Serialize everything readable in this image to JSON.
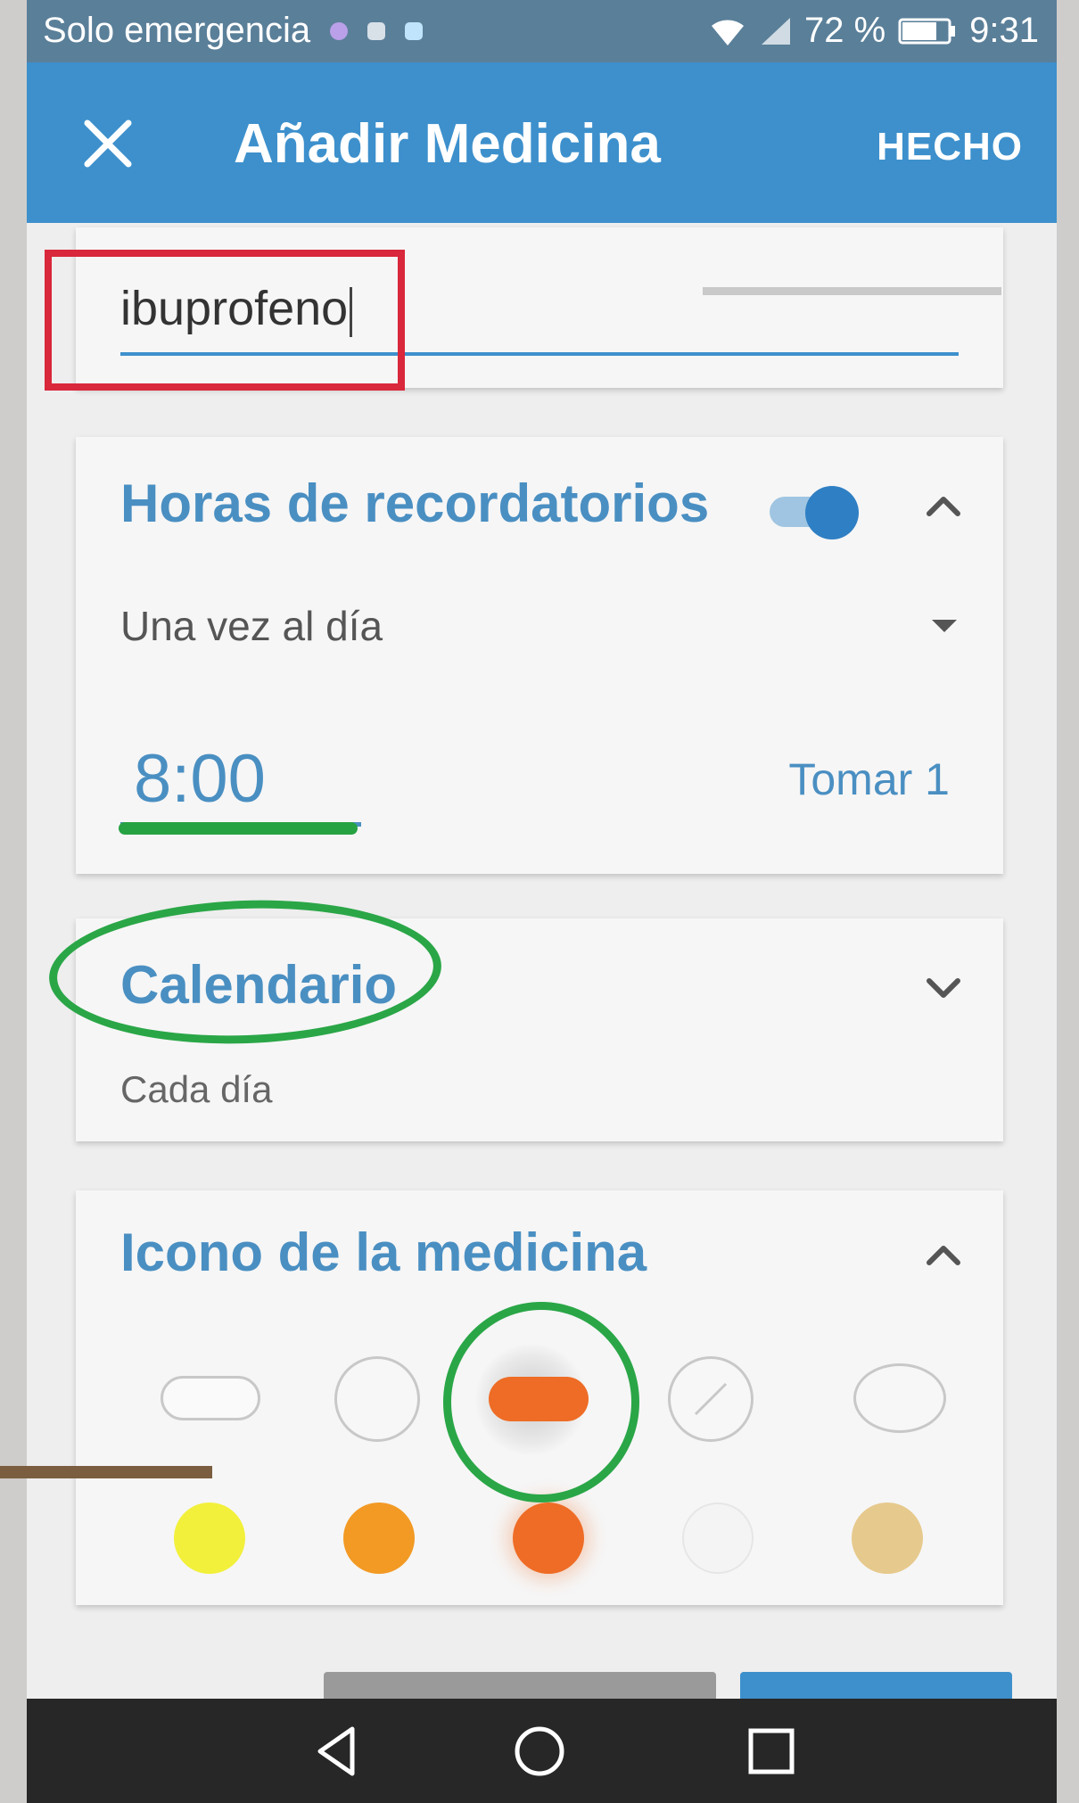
{
  "status_bar": {
    "carrier": "Solo emergencia",
    "battery": "72 %",
    "time": "9:31",
    "icons": [
      "notification-icon",
      "message-icon",
      "app-icon",
      "wifi-icon",
      "signal-icon",
      "battery-icon"
    ]
  },
  "app_bar": {
    "title": "Añadir Medicina",
    "done_label": "HECHO",
    "close_icon": "close-icon"
  },
  "medicine_name": {
    "value": "ibuprofeno"
  },
  "reminders": {
    "title": "Horas de recordatorios",
    "enabled": true,
    "frequency": "Una vez al día",
    "time": "8:00",
    "dose": "Tomar 1"
  },
  "calendar": {
    "title": "Calendario",
    "subtitle": "Cada día"
  },
  "medicine_icon": {
    "title": "Icono de la medicina",
    "shapes": [
      "capsule-icon",
      "round-pill-icon",
      "capsule-pill-icon",
      "split-pill-icon",
      "oval-pill-icon"
    ],
    "selected_shape": "capsule-pill-icon",
    "colors": [
      "#f2f03a",
      "#f29a24",
      "#ee6c25",
      "#f4f4f4",
      "#e6c98c"
    ],
    "selected_color": "#ee6c25"
  },
  "colors": {
    "app_bar": "#3d90cc",
    "accent": "#4a8fc2",
    "highlight_red": "#d9273b",
    "highlight_green": "#2aa647"
  }
}
